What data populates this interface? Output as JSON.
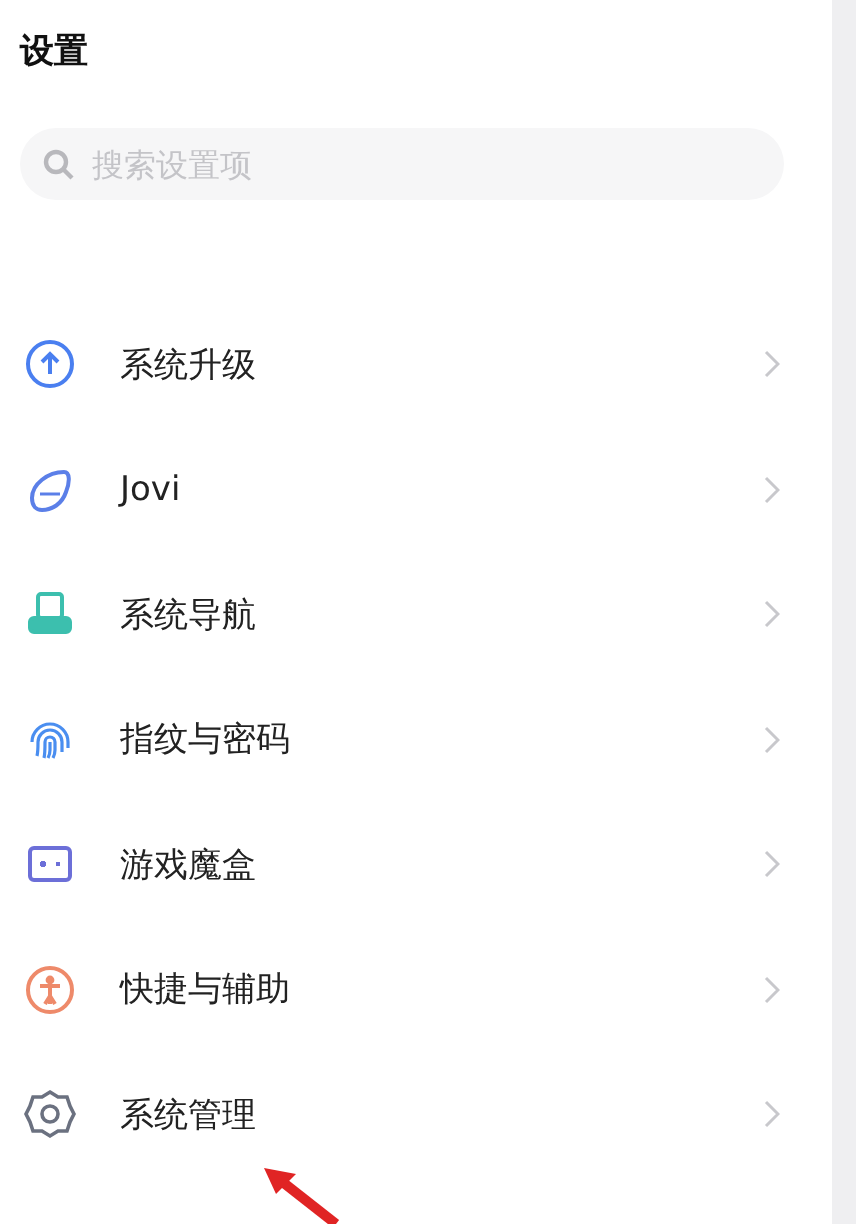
{
  "title": "设置",
  "search": {
    "placeholder": "搜索设置项"
  },
  "items": [
    {
      "label": "系统升级",
      "kind": "upgrade",
      "color": "#4a7ff0"
    },
    {
      "label": "Jovi",
      "kind": "jovi",
      "color": "#5b7fe8"
    },
    {
      "label": "系统导航",
      "kind": "navigation",
      "color": "#3cbfae"
    },
    {
      "label": "指纹与密码",
      "kind": "fingerprint",
      "color": "#4a8ef0"
    },
    {
      "label": "游戏魔盒",
      "kind": "game",
      "color": "#6c6fd8"
    },
    {
      "label": "快捷与辅助",
      "kind": "accessibility",
      "color": "#ee8a6a"
    },
    {
      "label": "系统管理",
      "kind": "gear",
      "color": "#6b7180"
    }
  ]
}
